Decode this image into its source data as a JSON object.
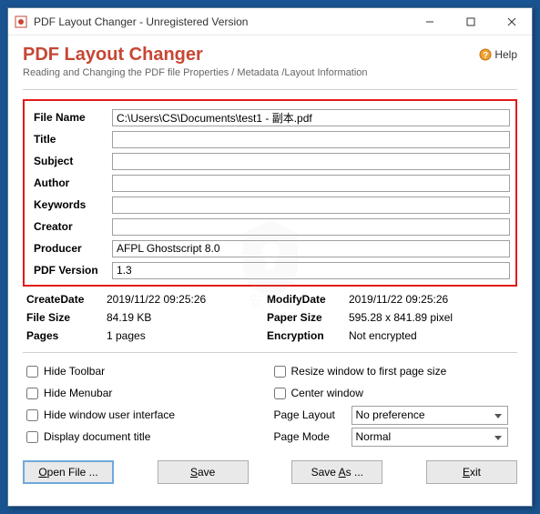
{
  "titlebar": {
    "text": "PDF Layout Changer - Unregistered Version"
  },
  "header": {
    "title": "PDF Layout Changer",
    "subtitle": "Reading and Changing the PDF file Properties / Metadata /Layout Information",
    "help": "Help"
  },
  "fields": {
    "file_name": {
      "label": "File Name",
      "value": "C:\\Users\\CS\\Documents\\test1 - 副本.pdf"
    },
    "title": {
      "label": "Title",
      "value": ""
    },
    "subject": {
      "label": "Subject",
      "value": ""
    },
    "author": {
      "label": "Author",
      "value": ""
    },
    "keywords": {
      "label": "Keywords",
      "value": ""
    },
    "creator": {
      "label": "Creator",
      "value": ""
    },
    "producer": {
      "label": "Producer",
      "value": "AFPL Ghostscript 8.0"
    },
    "pdf_version": {
      "label": "PDF Version",
      "value": "1.3"
    }
  },
  "info": {
    "create_date": {
      "label": "CreateDate",
      "value": "2019/11/22 09:25:26"
    },
    "modify_date": {
      "label": "ModifyDate",
      "value": "2019/11/22 09:25:26"
    },
    "file_size": {
      "label": "File Size",
      "value": "84.19 KB"
    },
    "paper_size": {
      "label": "Paper Size",
      "value": "595.28 x 841.89 pixel"
    },
    "pages": {
      "label": "Pages",
      "value": "1 pages"
    },
    "encryption": {
      "label": "Encryption",
      "value": "Not encrypted"
    }
  },
  "options": {
    "hide_toolbar": "Hide Toolbar",
    "hide_menubar": "Hide Menubar",
    "hide_window_ui": "Hide window user interface",
    "display_doc_title": "Display document title",
    "resize_window": "Resize window to first page size",
    "center_window": "Center window",
    "page_layout_label": "Page Layout",
    "page_layout_value": "No preference",
    "page_mode_label": "Page Mode",
    "page_mode_value": "Normal"
  },
  "buttons": {
    "open": "Open File ...",
    "save": "Save",
    "saveas": "Save As ...",
    "exit": "Exit"
  },
  "watermark": "安下载"
}
